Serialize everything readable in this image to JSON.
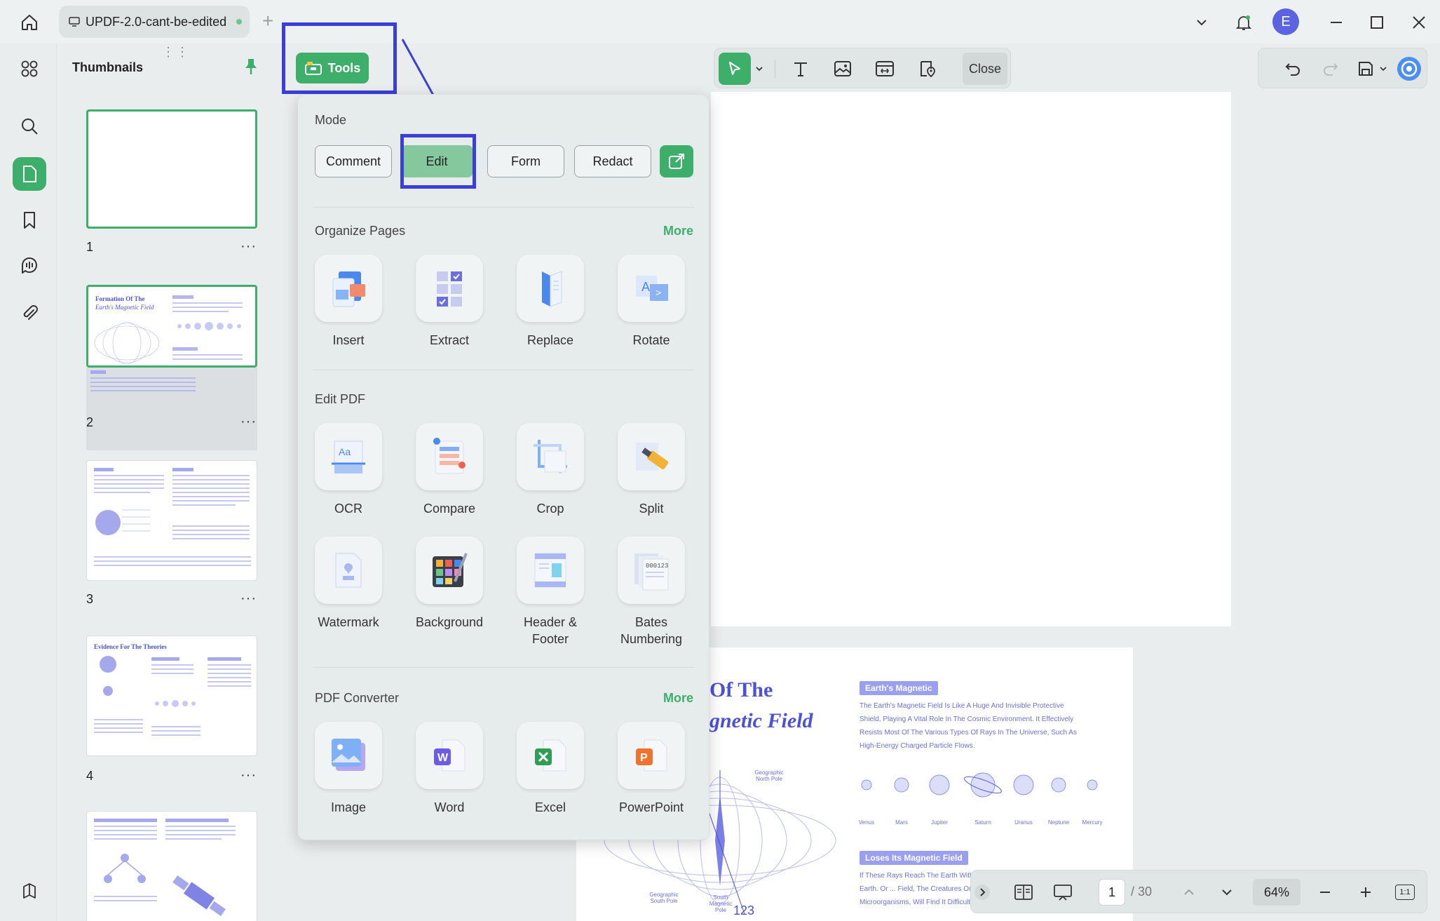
{
  "titlebar": {
    "tab_title": "UPDF-2.0-cant-be-edited",
    "avatar_letter": "E"
  },
  "sidebar": {
    "title": "Thumbnails",
    "pages": [
      {
        "num": "1"
      },
      {
        "num": "2"
      },
      {
        "num": "3"
      },
      {
        "num": "4"
      }
    ],
    "more_glyph": "···"
  },
  "toolbar": {
    "tools_label": "Tools",
    "close_label": "Close"
  },
  "tools_panel": {
    "mode": {
      "title": "Mode",
      "buttons": [
        "Comment",
        "Edit",
        "Form",
        "Redact"
      ],
      "active": "Edit"
    },
    "organize": {
      "title": "Organize Pages",
      "more": "More",
      "items": [
        "Insert",
        "Extract",
        "Replace",
        "Rotate"
      ]
    },
    "edit_pdf": {
      "title": "Edit PDF",
      "items": [
        "OCR",
        "Compare",
        "Crop",
        "Split",
        "Watermark",
        "Background",
        "Header & Footer",
        "Bates Numbering"
      ]
    },
    "converter": {
      "title": "PDF Converter",
      "more": "More",
      "items": [
        "Image",
        "Word",
        "Excel",
        "PowerPoint"
      ]
    }
  },
  "statusbar": {
    "current_page": "1",
    "total_pages": "/ 30",
    "zoom": "64%",
    "fit_label": "1:1"
  },
  "page2": {
    "title_line1": "Of The",
    "title_line2": "gnetic Field",
    "badge1": "Earth's Magnetic",
    "text1": "The Earth's Magnetic Field Is Like A Huge And Invisible Protective Shield, Playing A Vital Role In The Cosmic Environment. It Effectively Resists Most Of The Various Types Of Rays In The Universe, Such As High-Energy Charged Particle Flows.",
    "planets": [
      "Venus",
      "Mars",
      "Jupiter",
      "Saturn",
      "Uranus",
      "Neptune",
      "Mercury"
    ],
    "badge2": "Loses Its Magnetic Field",
    "text2": "If These Rays Reach The Earth Without ... Devastating Blow To Life On Earth. Or ... Field, The Creatures On The Earth's S... Animals Or Tiny Microorganisms, Will Find It Difficult To Survive Under The",
    "pole_labels": [
      "Geographic North Pole",
      "Geographic South Pole",
      "South Magnetic Pole"
    ],
    "page_number": "123"
  },
  "colors": {
    "accent_green": "#3daf6a",
    "highlight_blue": "#3b3fd6",
    "doc_purple": "#4b52d8"
  }
}
